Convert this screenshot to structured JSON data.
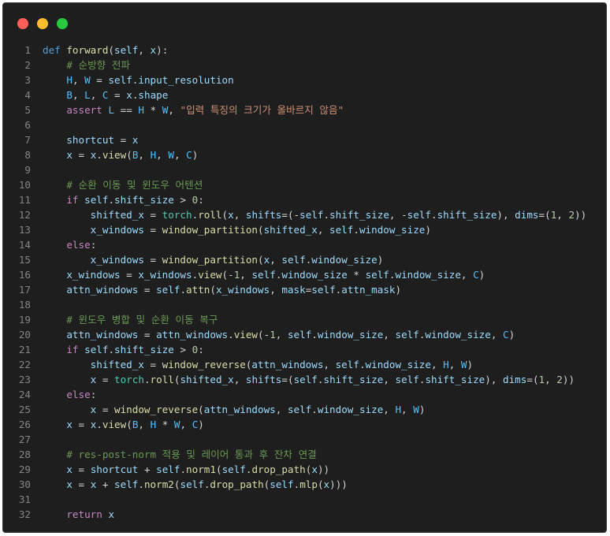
{
  "window": {
    "buttons": [
      "close",
      "minimize",
      "maximize"
    ],
    "colors": {
      "close": "#ff5f56",
      "minimize": "#ffbd2e",
      "maximize": "#27c93f",
      "background": "#1e1e1e"
    }
  },
  "code": {
    "language": "python",
    "lines": [
      [
        {
          "t": "def",
          "c": "kw"
        },
        {
          "t": " "
        },
        {
          "t": "forward",
          "c": "fn"
        },
        {
          "t": "("
        },
        {
          "t": "self",
          "c": "vr"
        },
        {
          "t": ", "
        },
        {
          "t": "x",
          "c": "vr"
        },
        {
          "t": "):"
        }
      ],
      [
        {
          "t": "    "
        },
        {
          "t": "# 순방향 전파",
          "c": "cmt"
        }
      ],
      [
        {
          "t": "    "
        },
        {
          "t": "H",
          "c": "cst"
        },
        {
          "t": ", "
        },
        {
          "t": "W",
          "c": "cst"
        },
        {
          "t": " = "
        },
        {
          "t": "self",
          "c": "vr"
        },
        {
          "t": "."
        },
        {
          "t": "input_resolution",
          "c": "vr"
        }
      ],
      [
        {
          "t": "    "
        },
        {
          "t": "B",
          "c": "cst"
        },
        {
          "t": ", "
        },
        {
          "t": "L",
          "c": "cst"
        },
        {
          "t": ", "
        },
        {
          "t": "C",
          "c": "cst"
        },
        {
          "t": " = "
        },
        {
          "t": "x",
          "c": "vr"
        },
        {
          "t": "."
        },
        {
          "t": "shape",
          "c": "vr"
        }
      ],
      [
        {
          "t": "    "
        },
        {
          "t": "assert",
          "c": "ctrl"
        },
        {
          "t": " "
        },
        {
          "t": "L",
          "c": "cst"
        },
        {
          "t": " == "
        },
        {
          "t": "H",
          "c": "cst"
        },
        {
          "t": " * "
        },
        {
          "t": "W",
          "c": "cst"
        },
        {
          "t": ", "
        },
        {
          "t": "\"입력 특징의 크기가 올바르지 않음\"",
          "c": "str"
        }
      ],
      [],
      [
        {
          "t": "    "
        },
        {
          "t": "shortcut",
          "c": "vr"
        },
        {
          "t": " = "
        },
        {
          "t": "x",
          "c": "vr"
        }
      ],
      [
        {
          "t": "    "
        },
        {
          "t": "x",
          "c": "vr"
        },
        {
          "t": " = "
        },
        {
          "t": "x",
          "c": "vr"
        },
        {
          "t": "."
        },
        {
          "t": "view",
          "c": "fn"
        },
        {
          "t": "("
        },
        {
          "t": "B",
          "c": "cst"
        },
        {
          "t": ", "
        },
        {
          "t": "H",
          "c": "cst"
        },
        {
          "t": ", "
        },
        {
          "t": "W",
          "c": "cst"
        },
        {
          "t": ", "
        },
        {
          "t": "C",
          "c": "cst"
        },
        {
          "t": ")"
        }
      ],
      [],
      [
        {
          "t": "    "
        },
        {
          "t": "# 순환 이동 및 윈도우 어텐션",
          "c": "cmt"
        }
      ],
      [
        {
          "t": "    "
        },
        {
          "t": "if",
          "c": "ctrl"
        },
        {
          "t": " "
        },
        {
          "t": "self",
          "c": "vr"
        },
        {
          "t": "."
        },
        {
          "t": "shift_size",
          "c": "vr"
        },
        {
          "t": " > "
        },
        {
          "t": "0",
          "c": "num"
        },
        {
          "t": ":"
        }
      ],
      [
        {
          "t": "        "
        },
        {
          "t": "shifted_x",
          "c": "vr"
        },
        {
          "t": " = "
        },
        {
          "t": "torch",
          "c": "cls"
        },
        {
          "t": "."
        },
        {
          "t": "roll",
          "c": "fn"
        },
        {
          "t": "("
        },
        {
          "t": "x",
          "c": "vr"
        },
        {
          "t": ", "
        },
        {
          "t": "shifts",
          "c": "vr"
        },
        {
          "t": "=(-"
        },
        {
          "t": "self",
          "c": "vr"
        },
        {
          "t": "."
        },
        {
          "t": "shift_size",
          "c": "vr"
        },
        {
          "t": ", -"
        },
        {
          "t": "self",
          "c": "vr"
        },
        {
          "t": "."
        },
        {
          "t": "shift_size",
          "c": "vr"
        },
        {
          "t": "), "
        },
        {
          "t": "dims",
          "c": "vr"
        },
        {
          "t": "=("
        },
        {
          "t": "1",
          "c": "num"
        },
        {
          "t": ", "
        },
        {
          "t": "2",
          "c": "num"
        },
        {
          "t": "))"
        }
      ],
      [
        {
          "t": "        "
        },
        {
          "t": "x_windows",
          "c": "vr"
        },
        {
          "t": " = "
        },
        {
          "t": "window_partition",
          "c": "fn"
        },
        {
          "t": "("
        },
        {
          "t": "shifted_x",
          "c": "vr"
        },
        {
          "t": ", "
        },
        {
          "t": "self",
          "c": "vr"
        },
        {
          "t": "."
        },
        {
          "t": "window_size",
          "c": "vr"
        },
        {
          "t": ")"
        }
      ],
      [
        {
          "t": "    "
        },
        {
          "t": "else",
          "c": "ctrl"
        },
        {
          "t": ":"
        }
      ],
      [
        {
          "t": "        "
        },
        {
          "t": "x_windows",
          "c": "vr"
        },
        {
          "t": " = "
        },
        {
          "t": "window_partition",
          "c": "fn"
        },
        {
          "t": "("
        },
        {
          "t": "x",
          "c": "vr"
        },
        {
          "t": ", "
        },
        {
          "t": "self",
          "c": "vr"
        },
        {
          "t": "."
        },
        {
          "t": "window_size",
          "c": "vr"
        },
        {
          "t": ")"
        }
      ],
      [
        {
          "t": "    "
        },
        {
          "t": "x_windows",
          "c": "vr"
        },
        {
          "t": " = "
        },
        {
          "t": "x_windows",
          "c": "vr"
        },
        {
          "t": "."
        },
        {
          "t": "view",
          "c": "fn"
        },
        {
          "t": "(-"
        },
        {
          "t": "1",
          "c": "num"
        },
        {
          "t": ", "
        },
        {
          "t": "self",
          "c": "vr"
        },
        {
          "t": "."
        },
        {
          "t": "window_size",
          "c": "vr"
        },
        {
          "t": " * "
        },
        {
          "t": "self",
          "c": "vr"
        },
        {
          "t": "."
        },
        {
          "t": "window_size",
          "c": "vr"
        },
        {
          "t": ", "
        },
        {
          "t": "C",
          "c": "cst"
        },
        {
          "t": ")"
        }
      ],
      [
        {
          "t": "    "
        },
        {
          "t": "attn_windows",
          "c": "vr"
        },
        {
          "t": " = "
        },
        {
          "t": "self",
          "c": "vr"
        },
        {
          "t": "."
        },
        {
          "t": "attn",
          "c": "fn"
        },
        {
          "t": "("
        },
        {
          "t": "x_windows",
          "c": "vr"
        },
        {
          "t": ", "
        },
        {
          "t": "mask",
          "c": "vr"
        },
        {
          "t": "="
        },
        {
          "t": "self",
          "c": "vr"
        },
        {
          "t": "."
        },
        {
          "t": "attn_mask",
          "c": "vr"
        },
        {
          "t": ")"
        }
      ],
      [],
      [
        {
          "t": "    "
        },
        {
          "t": "# 윈도우 병합 및 순환 이동 복구",
          "c": "cmt"
        }
      ],
      [
        {
          "t": "    "
        },
        {
          "t": "attn_windows",
          "c": "vr"
        },
        {
          "t": " = "
        },
        {
          "t": "attn_windows",
          "c": "vr"
        },
        {
          "t": "."
        },
        {
          "t": "view",
          "c": "fn"
        },
        {
          "t": "(-"
        },
        {
          "t": "1",
          "c": "num"
        },
        {
          "t": ", "
        },
        {
          "t": "self",
          "c": "vr"
        },
        {
          "t": "."
        },
        {
          "t": "window_size",
          "c": "vr"
        },
        {
          "t": ", "
        },
        {
          "t": "self",
          "c": "vr"
        },
        {
          "t": "."
        },
        {
          "t": "window_size",
          "c": "vr"
        },
        {
          "t": ", "
        },
        {
          "t": "C",
          "c": "cst"
        },
        {
          "t": ")"
        }
      ],
      [
        {
          "t": "    "
        },
        {
          "t": "if",
          "c": "ctrl"
        },
        {
          "t": " "
        },
        {
          "t": "self",
          "c": "vr"
        },
        {
          "t": "."
        },
        {
          "t": "shift_size",
          "c": "vr"
        },
        {
          "t": " > "
        },
        {
          "t": "0",
          "c": "num"
        },
        {
          "t": ":"
        }
      ],
      [
        {
          "t": "        "
        },
        {
          "t": "shifted_x",
          "c": "vr"
        },
        {
          "t": " = "
        },
        {
          "t": "window_reverse",
          "c": "fn"
        },
        {
          "t": "("
        },
        {
          "t": "attn_windows",
          "c": "vr"
        },
        {
          "t": ", "
        },
        {
          "t": "self",
          "c": "vr"
        },
        {
          "t": "."
        },
        {
          "t": "window_size",
          "c": "vr"
        },
        {
          "t": ", "
        },
        {
          "t": "H",
          "c": "cst"
        },
        {
          "t": ", "
        },
        {
          "t": "W",
          "c": "cst"
        },
        {
          "t": ")"
        }
      ],
      [
        {
          "t": "        "
        },
        {
          "t": "x",
          "c": "vr"
        },
        {
          "t": " = "
        },
        {
          "t": "torch",
          "c": "cls"
        },
        {
          "t": "."
        },
        {
          "t": "roll",
          "c": "fn"
        },
        {
          "t": "("
        },
        {
          "t": "shifted_x",
          "c": "vr"
        },
        {
          "t": ", "
        },
        {
          "t": "shifts",
          "c": "vr"
        },
        {
          "t": "=("
        },
        {
          "t": "self",
          "c": "vr"
        },
        {
          "t": "."
        },
        {
          "t": "shift_size",
          "c": "vr"
        },
        {
          "t": ", "
        },
        {
          "t": "self",
          "c": "vr"
        },
        {
          "t": "."
        },
        {
          "t": "shift_size",
          "c": "vr"
        },
        {
          "t": "), "
        },
        {
          "t": "dims",
          "c": "vr"
        },
        {
          "t": "=("
        },
        {
          "t": "1",
          "c": "num"
        },
        {
          "t": ", "
        },
        {
          "t": "2",
          "c": "num"
        },
        {
          "t": "))"
        }
      ],
      [
        {
          "t": "    "
        },
        {
          "t": "else",
          "c": "ctrl"
        },
        {
          "t": ":"
        }
      ],
      [
        {
          "t": "        "
        },
        {
          "t": "x",
          "c": "vr"
        },
        {
          "t": " = "
        },
        {
          "t": "window_reverse",
          "c": "fn"
        },
        {
          "t": "("
        },
        {
          "t": "attn_windows",
          "c": "vr"
        },
        {
          "t": ", "
        },
        {
          "t": "self",
          "c": "vr"
        },
        {
          "t": "."
        },
        {
          "t": "window_size",
          "c": "vr"
        },
        {
          "t": ", "
        },
        {
          "t": "H",
          "c": "cst"
        },
        {
          "t": ", "
        },
        {
          "t": "W",
          "c": "cst"
        },
        {
          "t": ")"
        }
      ],
      [
        {
          "t": "    "
        },
        {
          "t": "x",
          "c": "vr"
        },
        {
          "t": " = "
        },
        {
          "t": "x",
          "c": "vr"
        },
        {
          "t": "."
        },
        {
          "t": "view",
          "c": "fn"
        },
        {
          "t": "("
        },
        {
          "t": "B",
          "c": "cst"
        },
        {
          "t": ", "
        },
        {
          "t": "H",
          "c": "cst"
        },
        {
          "t": " * "
        },
        {
          "t": "W",
          "c": "cst"
        },
        {
          "t": ", "
        },
        {
          "t": "C",
          "c": "cst"
        },
        {
          "t": ")"
        }
      ],
      [],
      [
        {
          "t": "    "
        },
        {
          "t": "# res-post-norm 적용 및 레이어 통과 후 잔차 연결",
          "c": "cmt"
        }
      ],
      [
        {
          "t": "    "
        },
        {
          "t": "x",
          "c": "vr"
        },
        {
          "t": " = "
        },
        {
          "t": "shortcut",
          "c": "vr"
        },
        {
          "t": " + "
        },
        {
          "t": "self",
          "c": "vr"
        },
        {
          "t": "."
        },
        {
          "t": "norm1",
          "c": "fn"
        },
        {
          "t": "("
        },
        {
          "t": "self",
          "c": "vr"
        },
        {
          "t": "."
        },
        {
          "t": "drop_path",
          "c": "fn"
        },
        {
          "t": "("
        },
        {
          "t": "x",
          "c": "vr"
        },
        {
          "t": "))"
        }
      ],
      [
        {
          "t": "    "
        },
        {
          "t": "x",
          "c": "vr"
        },
        {
          "t": " = "
        },
        {
          "t": "x",
          "c": "vr"
        },
        {
          "t": " + "
        },
        {
          "t": "self",
          "c": "vr"
        },
        {
          "t": "."
        },
        {
          "t": "norm2",
          "c": "fn"
        },
        {
          "t": "("
        },
        {
          "t": "self",
          "c": "vr"
        },
        {
          "t": "."
        },
        {
          "t": "drop_path",
          "c": "fn"
        },
        {
          "t": "("
        },
        {
          "t": "self",
          "c": "vr"
        },
        {
          "t": "."
        },
        {
          "t": "mlp",
          "c": "fn"
        },
        {
          "t": "("
        },
        {
          "t": "x",
          "c": "vr"
        },
        {
          "t": ")))"
        }
      ],
      [],
      [
        {
          "t": "    "
        },
        {
          "t": "return",
          "c": "ctrl"
        },
        {
          "t": " "
        },
        {
          "t": "x",
          "c": "vr"
        }
      ]
    ]
  }
}
